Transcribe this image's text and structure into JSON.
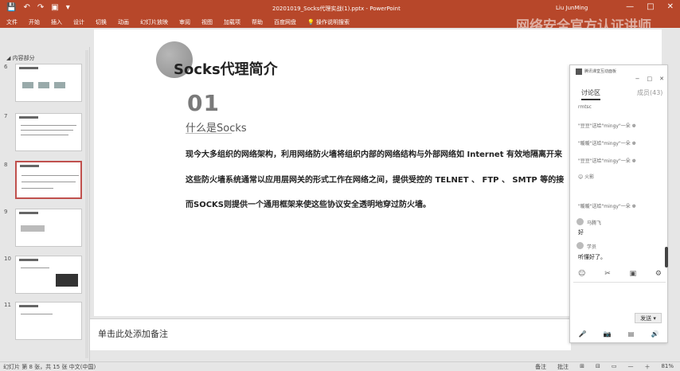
{
  "app": {
    "title": "20201019_Socks代理实战(1).pptx - PowerPoint",
    "user": "Liu JunMing",
    "quick_access": [
      "💾",
      "↶",
      "↷",
      "▣",
      "▾"
    ],
    "window_controls": [
      "—",
      "□",
      "✕"
    ]
  },
  "ribbon": {
    "tabs": [
      "文件",
      "开始",
      "插入",
      "设计",
      "切换",
      "动画",
      "幻灯片放映",
      "审阅",
      "视图",
      "加载项",
      "帮助",
      "百度网盘",
      "💡 操作说明搜索"
    ]
  },
  "watermark": "网络安全官方认证讲师",
  "thumbnails": {
    "section": "◢ 内容部分",
    "items": [
      {
        "num": "6"
      },
      {
        "num": "7"
      },
      {
        "num": "8"
      },
      {
        "num": "9"
      },
      {
        "num": "10"
      },
      {
        "num": "11"
      }
    ]
  },
  "slide": {
    "title": "Socks代理简介",
    "number": "01",
    "subtitle": "什么是Socks",
    "paragraphs": [
      "现今大多组织的网络架构，利用网络防火墙将组织内部的网络结构与外部网络如 Internet 有效地隔离开来",
      "这些防火墙系统通常以应用层网关的形式工作在网络之间，提供受控的 TELNET 、 FTP 、 SMTP 等的接",
      "而SOCKS则提供一个通用框架来使这些协议安全透明地穿过防火墙。"
    ]
  },
  "notes": {
    "placeholder": "单击此处添加备注"
  },
  "statusbar": {
    "left": "幻灯片 第 8 张，共 15 张   中文(中国)",
    "right": [
      "备注",
      "批注",
      "⊞",
      "⊟",
      "▭",
      "—",
      "＋",
      "81%"
    ]
  },
  "chat_panel": {
    "header": "腾讯课堂互动面板",
    "controls": [
      "−",
      "□",
      "✕"
    ],
    "tabs": [
      "讨论区",
      "成员(43)"
    ],
    "messages": [
      {
        "text": "rmtsc",
        "dark": false
      },
      {
        "text": "\"豆豆\"送给\"mingy\"一朵 ❁",
        "dark": false
      },
      {
        "text": "\"暖暖\"送给\"mingy\"一朵 ❁",
        "dark": false
      },
      {
        "text": "\"豆豆\"送给\"mingy\"一朵 ❁",
        "dark": false
      },
      {
        "text": "☺ 火影",
        "dark": false
      },
      {
        "text": "\"暖暖\"送给\"mingy\"一朵 ❁",
        "dark": false
      },
      {
        "text": "马腾飞",
        "dark": false
      },
      {
        "text": "好",
        "dark": true
      },
      {
        "text": "学员",
        "dark": false
      },
      {
        "text": "听懂好了。",
        "dark": true
      }
    ],
    "tools": [
      "☺",
      "✂",
      "▣",
      "⚙"
    ],
    "send_label": "发送 ▾",
    "footer": [
      "🎤",
      "📷",
      "▤",
      "🔊"
    ]
  }
}
